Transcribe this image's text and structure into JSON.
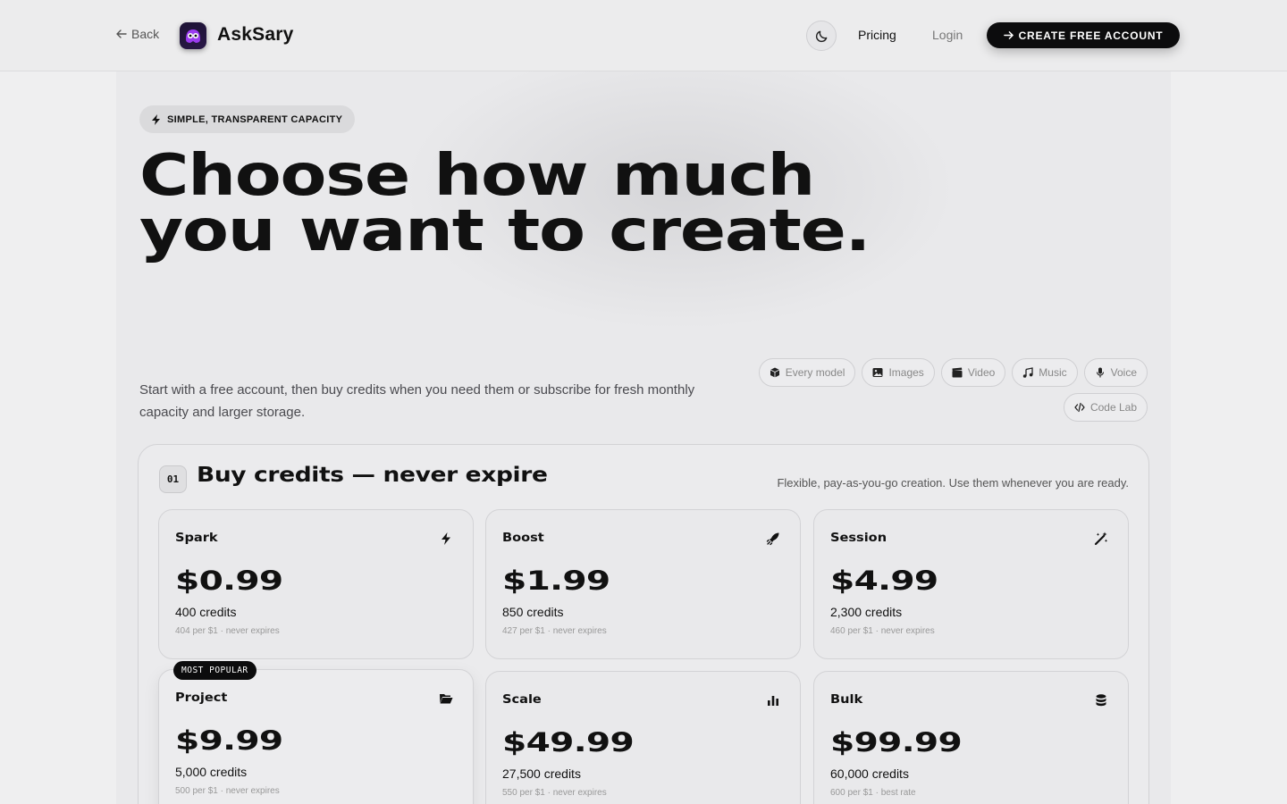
{
  "header": {
    "back_label": "Back",
    "brand": "AskSary",
    "nav_pricing": "Pricing",
    "nav_login": "Login",
    "cta_label": "CREATE FREE ACCOUNT"
  },
  "hero": {
    "tag": "SIMPLE, TRANSPARENT CAPACITY",
    "title": "Choose how much you want to create.",
    "subtitle": "Start with a free account, then buy credits when you need them or subscribe for fresh monthly capacity and larger storage."
  },
  "chips": [
    {
      "label": "Every model",
      "icon": "cube-icon"
    },
    {
      "label": "Images",
      "icon": "image-icon"
    },
    {
      "label": "Video",
      "icon": "clapperboard-icon"
    },
    {
      "label": "Music",
      "icon": "music-note-icon"
    },
    {
      "label": "Voice",
      "icon": "microphone-icon"
    },
    {
      "label": "Code Lab",
      "icon": "code-icon"
    }
  ],
  "credits_section": {
    "number": "01",
    "title": "Buy credits — never expire",
    "description": "Flexible, pay-as-you-go creation. Use them whenever you are ready.",
    "popular_badge": "MOST POPULAR",
    "plans": [
      {
        "name": "Spark",
        "price": "$0.99",
        "credits": "400 credits",
        "note": "404 per $1 · never expires",
        "icon": "bolt-icon"
      },
      {
        "name": "Boost",
        "price": "$1.99",
        "credits": "850 credits",
        "note": "427 per $1 · never expires",
        "icon": "rocket-icon"
      },
      {
        "name": "Session",
        "price": "$4.99",
        "credits": "2,300 credits",
        "note": "460 per $1 · never expires",
        "icon": "magic-wand-icon"
      },
      {
        "name": "Project",
        "price": "$9.99",
        "credits": "5,000 credits",
        "note": "500 per $1 · never expires",
        "icon": "folder-open-icon"
      },
      {
        "name": "Scale",
        "price": "$49.99",
        "credits": "27,500 credits",
        "note": "550 per $1 · never expires",
        "icon": "bar-chart-icon"
      },
      {
        "name": "Bulk",
        "price": "$99.99",
        "credits": "60,000 credits",
        "note": "600 per $1 · best rate",
        "icon": "database-icon"
      }
    ]
  }
}
